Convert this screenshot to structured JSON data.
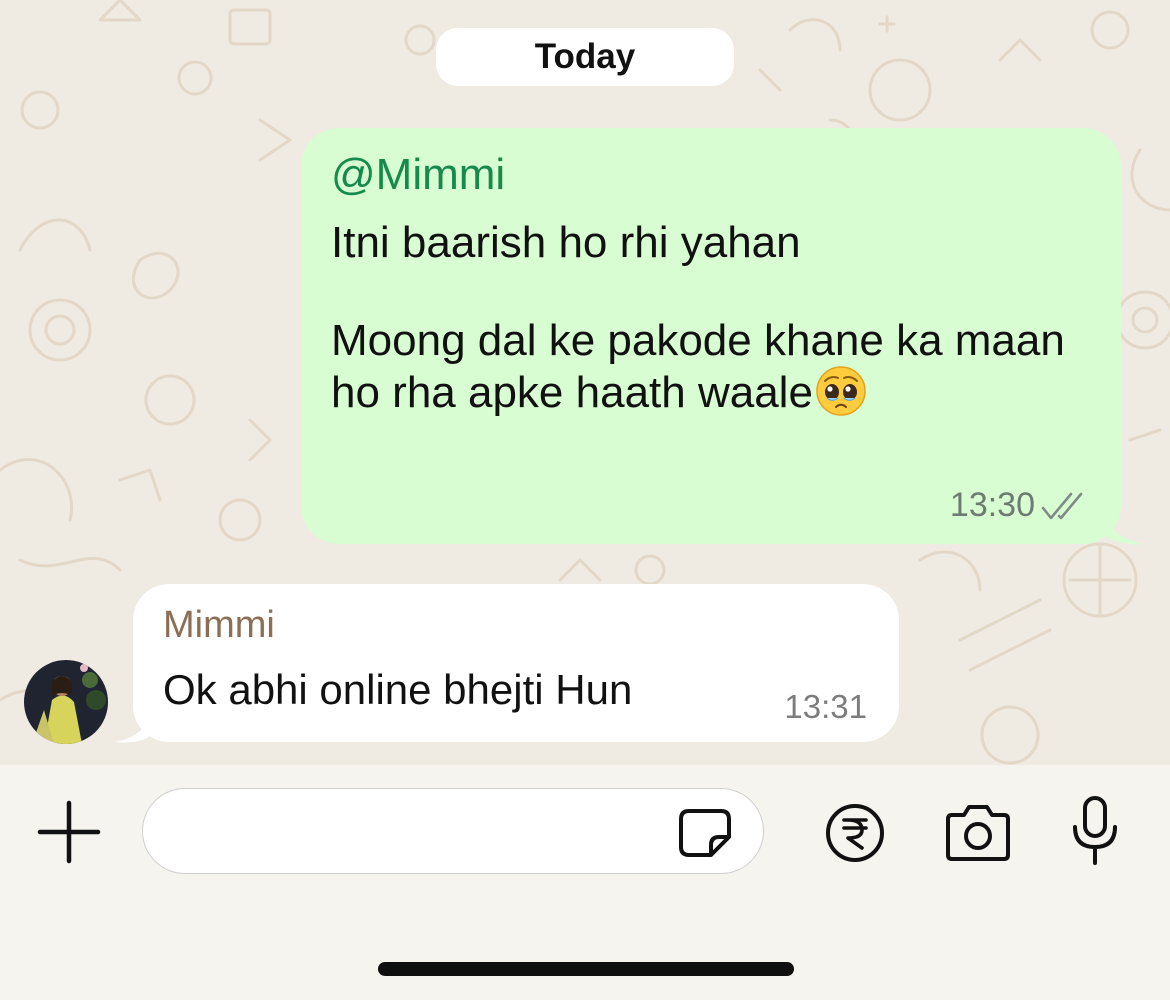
{
  "chat": {
    "date_divider": "Today",
    "outgoing": {
      "mention": "@Mimmi",
      "text": "Itni baarish ho rhi yahan\n\nMoong dal ke pakode khane ka maan ho rha apke haath waale",
      "emoji": "pleading-face",
      "time": "13:30",
      "status": "read"
    },
    "incoming": {
      "sender": "Mimmi",
      "text": "Ok abhi online bhejti Hun",
      "time": "13:31"
    }
  },
  "composer": {
    "placeholder": "",
    "icons": [
      "plus-icon",
      "sticker-icon",
      "rupee-icon",
      "camera-icon",
      "microphone-icon"
    ]
  },
  "colors": {
    "outgoing_bubble": "#d9fdd3",
    "incoming_bubble": "#ffffff",
    "mention": "#168a4b",
    "sender_name": "#8a6e55",
    "chat_background": "#efeae2"
  }
}
